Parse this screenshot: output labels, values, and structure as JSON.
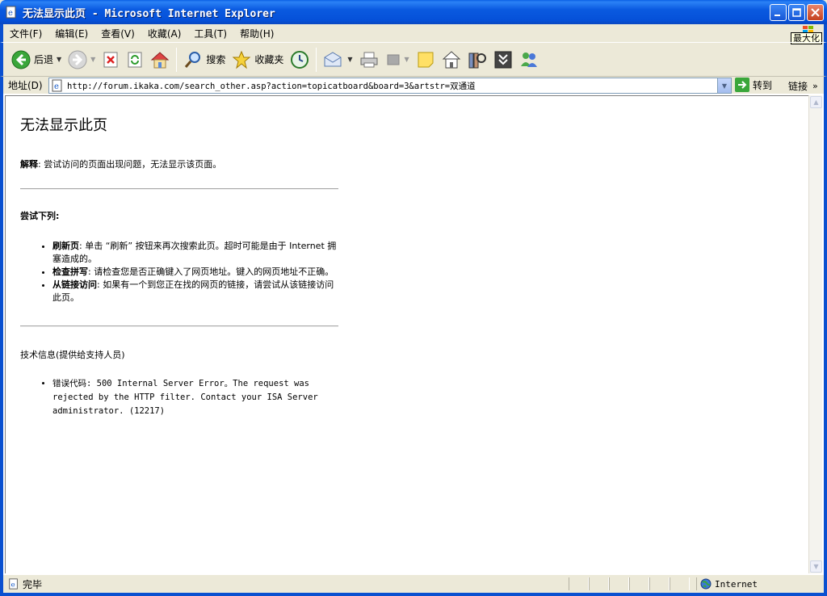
{
  "window": {
    "title": "无法显示此页 - Microsoft Internet Explorer",
    "maximize_tooltip": "最大化"
  },
  "menu": {
    "items": [
      "文件(F)",
      "编辑(E)",
      "查看(V)",
      "收藏(A)",
      "工具(T)",
      "帮助(H)"
    ]
  },
  "toolbar": {
    "back_label": "后退",
    "search_label": "搜索",
    "favorites_label": "收藏夹"
  },
  "address": {
    "label": "地址(D)",
    "url": "http://forum.ikaka.com/search_other.asp?action=topicatboard&board=3&artstr=双通道",
    "go_label": "转到",
    "links_label": "链接"
  },
  "page": {
    "title": "无法显示此页",
    "explain_label": "解释",
    "explain_text": ": 尝试访问的页面出现问题，无法显示该页面。",
    "try_heading": "尝试下列:",
    "suggestions": [
      {
        "label": "刷新页",
        "text": ": 单击 “刷新” 按钮来再次搜索此页。超时可能是由于 Internet 拥塞造成的。"
      },
      {
        "label": "检查拼写",
        "text": ": 请检查您是否正确键入了网页地址。键入的网页地址不正确。"
      },
      {
        "label": "从链接访问",
        "text": ": 如果有一个到您正在找的网页的链接，请尝试从该链接访问此页。"
      }
    ],
    "tech_heading": "技术信息(提供给支持人员)",
    "error_text": "错误代码: 500 Internal Server Error。The request was rejected by the HTTP filter. Contact your ISA Server administrator. (12217)"
  },
  "status": {
    "text": "完毕",
    "zone": "Internet"
  },
  "colors": {
    "titlebar": "#0a5ae0",
    "chrome": "#ece9d8",
    "frame": "#0a50d0"
  }
}
